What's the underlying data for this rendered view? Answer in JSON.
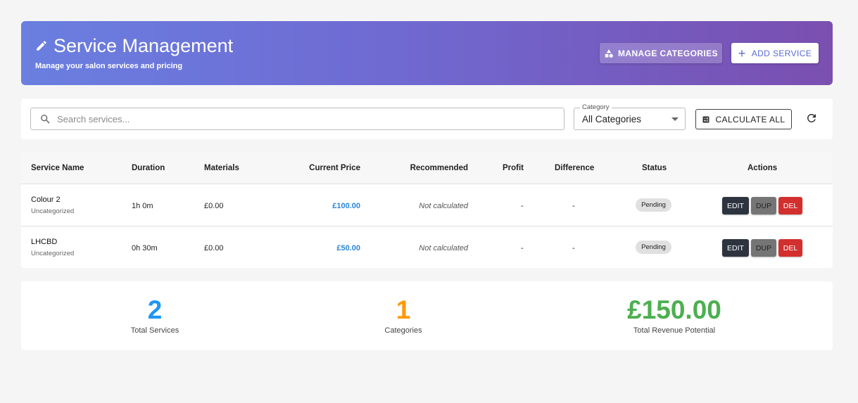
{
  "header": {
    "title": "Service Management",
    "subtitle": "Manage your salon services and pricing",
    "manage_categories_label": "MANAGE CATEGORIES",
    "add_service_label": "ADD SERVICE",
    "gradient_start": "#6a7fe0",
    "gradient_end": "#7a4fb0"
  },
  "toolbar": {
    "search_placeholder": "Search services...",
    "category_label": "Category",
    "category_value": "All Categories",
    "calculate_all_label": "CALCULATE ALL"
  },
  "table": {
    "columns": [
      "Service Name",
      "Duration",
      "Materials",
      "Current Price",
      "Recommended",
      "Profit",
      "Difference",
      "Status",
      "Actions"
    ],
    "rows": [
      {
        "name": "Colour 2",
        "category": "Uncategorized",
        "duration": "1h 0m",
        "materials": "£0.00",
        "current_price": "£100.00",
        "recommended": "Not calculated",
        "profit": "-",
        "difference": "-",
        "status": "Pending",
        "actions": [
          "EDIT",
          "DUP",
          "DEL"
        ]
      },
      {
        "name": "LHCBD",
        "category": "Uncategorized",
        "duration": "0h 30m",
        "materials": "£0.00",
        "current_price": "£50.00",
        "recommended": "Not calculated",
        "profit": "-",
        "difference": "-",
        "status": "Pending",
        "actions": [
          "EDIT",
          "DUP",
          "DEL"
        ]
      }
    ]
  },
  "stats": [
    {
      "value": "2",
      "label": "Total Services",
      "color": "#2196f3"
    },
    {
      "value": "1",
      "label": "Categories",
      "color": "#ff9800"
    },
    {
      "value": "£150.00",
      "label": "Total Revenue Potential",
      "color": "#4caf50"
    }
  ],
  "icons": [
    "pencil-icon",
    "shapes-icon",
    "plus-icon",
    "search-icon",
    "calculator-icon",
    "refresh-icon",
    "dropdown-caret-icon"
  ]
}
